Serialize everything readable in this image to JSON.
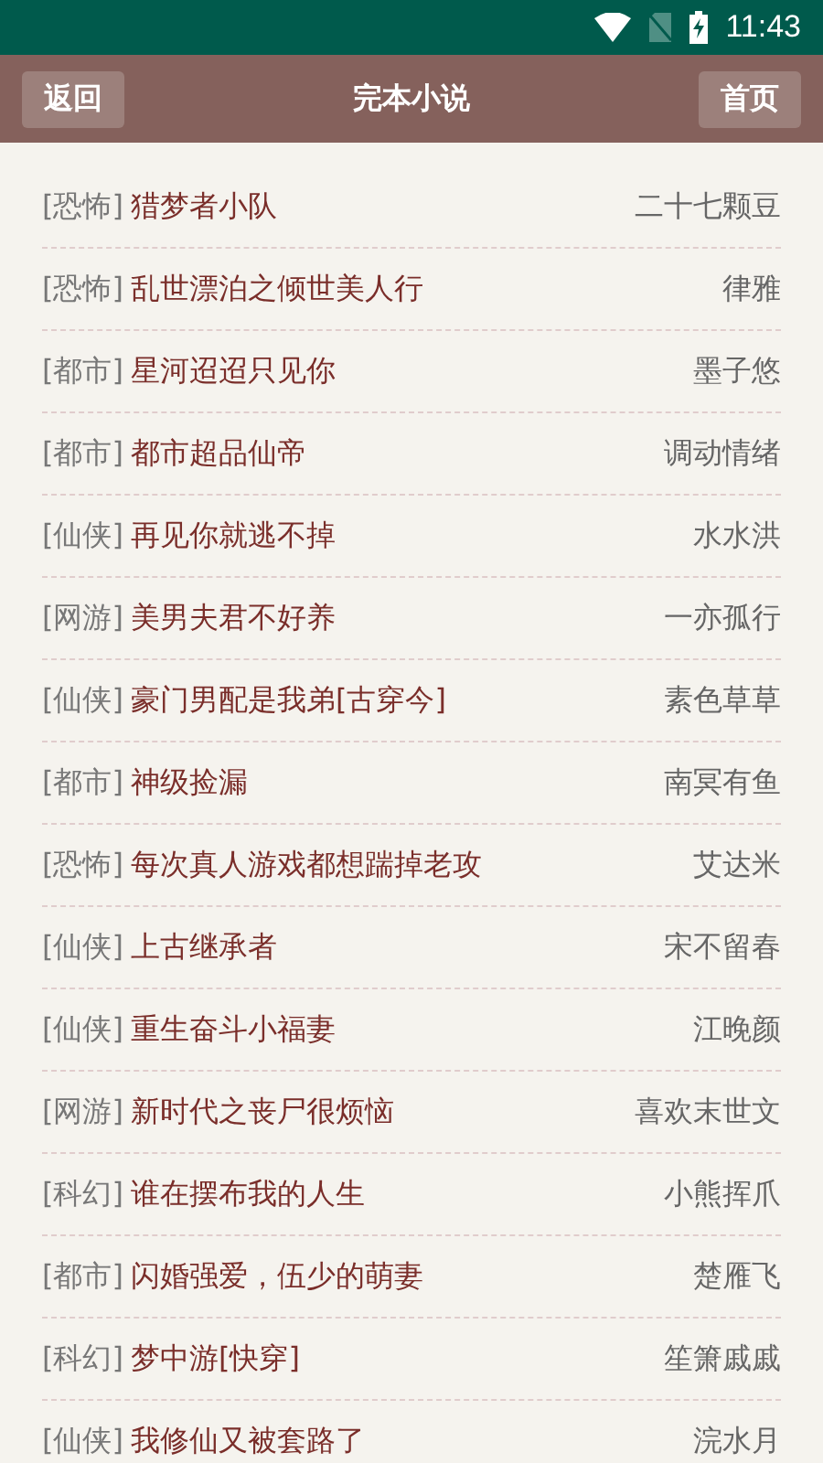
{
  "status_bar": {
    "time": "11:43"
  },
  "header": {
    "back": "返回",
    "title": "完本小说",
    "home": "首页"
  },
  "books": [
    {
      "genre": "[恐怖]",
      "title": "猎梦者小队",
      "author": "二十七颗豆"
    },
    {
      "genre": "[恐怖]",
      "title": "乱世漂泊之倾世美人行",
      "author": "律雅"
    },
    {
      "genre": "[都市]",
      "title": "星河迢迢只见你",
      "author": "墨子悠"
    },
    {
      "genre": "[都市]",
      "title": "都市超品仙帝",
      "author": "调动情绪"
    },
    {
      "genre": "[仙侠]",
      "title": "再见你就逃不掉",
      "author": "水水洪"
    },
    {
      "genre": "[网游]",
      "title": "美男夫君不好养",
      "author": "一亦孤行"
    },
    {
      "genre": "[仙侠]",
      "title": "豪门男配是我弟[古穿今]",
      "author": "素色草草"
    },
    {
      "genre": "[都市]",
      "title": "神级捡漏",
      "author": "南冥有鱼"
    },
    {
      "genre": "[恐怖]",
      "title": "每次真人游戏都想踹掉老攻",
      "author": "艾达米"
    },
    {
      "genre": "[仙侠]",
      "title": "上古继承者",
      "author": "宋不留春"
    },
    {
      "genre": "[仙侠]",
      "title": "重生奋斗小福妻",
      "author": "江晚颜"
    },
    {
      "genre": "[网游]",
      "title": "新时代之丧尸很烦恼",
      "author": "喜欢末世文"
    },
    {
      "genre": "[科幻]",
      "title": "谁在摆布我的人生",
      "author": "小熊挥爪"
    },
    {
      "genre": "[都市]",
      "title": "闪婚强爱，伍少的萌妻",
      "author": "楚雁飞"
    },
    {
      "genre": "[科幻]",
      "title": "梦中游[快穿]",
      "author": "笙箫戚戚"
    },
    {
      "genre": "[仙侠]",
      "title": "我修仙又被套路了",
      "author": "浣水月"
    }
  ]
}
